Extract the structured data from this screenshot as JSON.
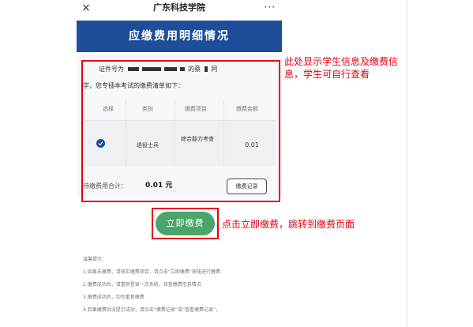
{
  "nav": {
    "close_icon": "×",
    "title": "广东科技学院",
    "more_icon": "···"
  },
  "banner": {
    "title": "应缴费用明细情况"
  },
  "info": {
    "line1_prefix": "证件号为",
    "line1_mid": "的蔡",
    "line1_suffix": "同",
    "line2": "学，您专插本考试的缴费清单如下："
  },
  "table": {
    "headers": [
      "选择",
      "类别",
      "缴费项目",
      "缴费金额"
    ],
    "rows": [
      {
        "category": "退役士兵",
        "item": "综合能力考查",
        "amount": "0.01",
        "selected": true
      }
    ]
  },
  "total": {
    "label": "待缴费用合计：",
    "value": "0.01 元"
  },
  "record_button": "缴费记录",
  "pay_button": "立即缴费",
  "tips": {
    "title": "温馨提示：",
    "items": [
      "1.如果未缴费，请核实缴费项目，请点击“立即缴费”按钮进行缴费",
      "2.缴费成功后，请重新登录一次系统，核查缴费信息情况",
      "3.缴费成功后，切勿重复缴费",
      "4.若果缴费后没提示成功，请点击“缴费记录”或“查看缴费记录”，"
    ]
  },
  "annotations": {
    "info_box": "此处显示学生信息及缴费信息，学生可自行查看",
    "pay_button": "点击立即缴费，跳转到缴费页面"
  },
  "colors": {
    "banner": "#1e4e9a",
    "pay_button": "#4aa56a",
    "annotation_red": "#e60012"
  }
}
